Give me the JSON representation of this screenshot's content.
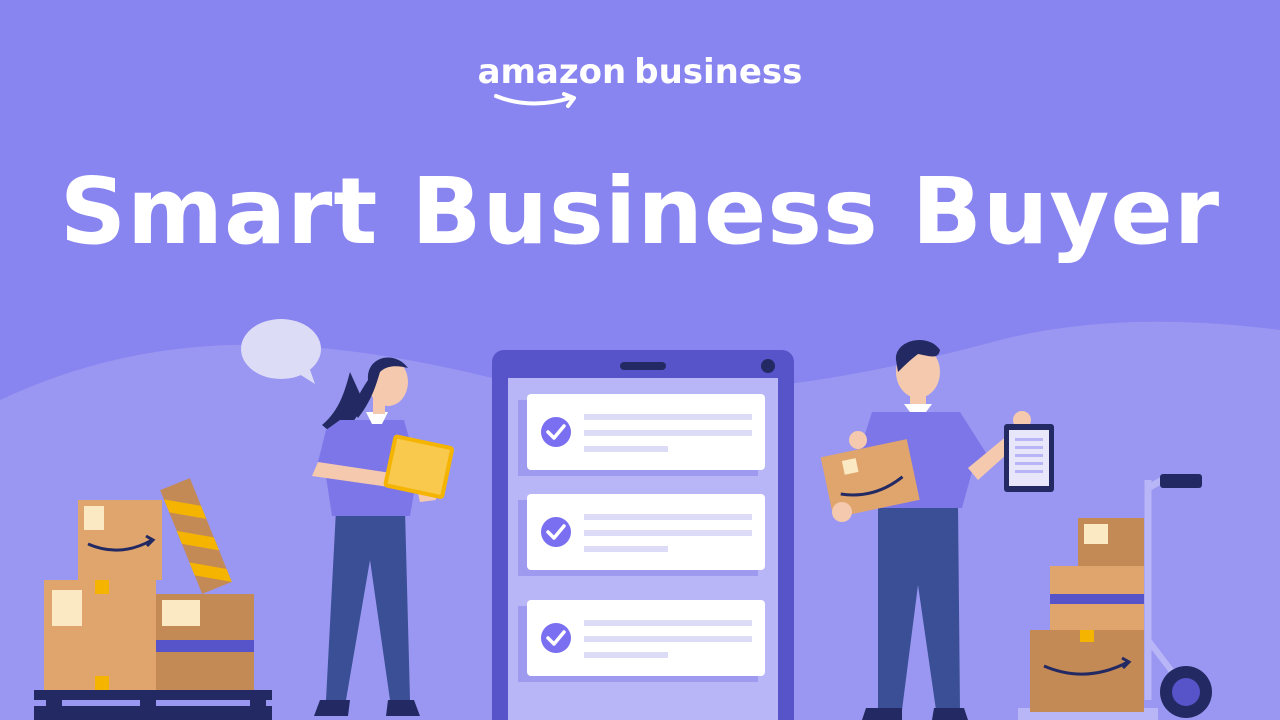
{
  "logo": {
    "word1": "amazon",
    "word2": "business"
  },
  "headline": "Smart Business Buyer",
  "checklist": {
    "item_count": 3
  },
  "colors": {
    "background": "#8884f0",
    "hill": "#9a97f2",
    "tablet_frame": "#5753c9",
    "tablet_screen": "#b8b6f7",
    "check": "#7a6ff0",
    "box": "#e0a56c",
    "box_dark": "#c48a55",
    "tape": "#f4b400",
    "pants": "#3a4f95",
    "shirt": "#7d76e8"
  }
}
